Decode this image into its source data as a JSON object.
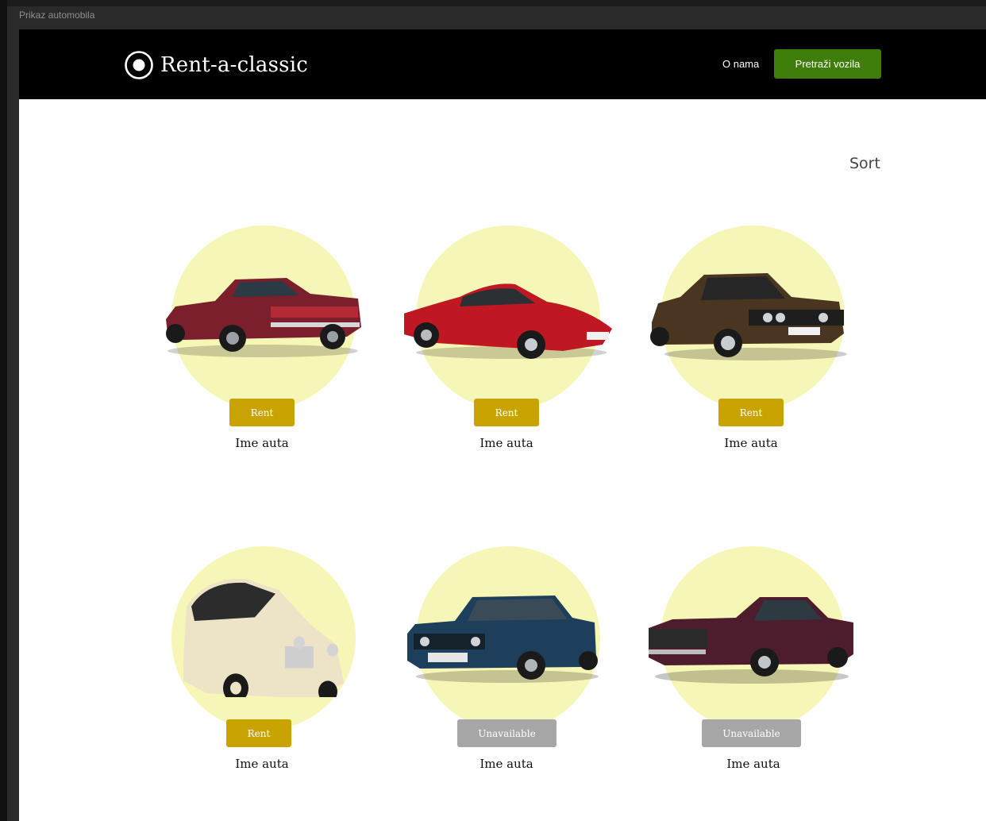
{
  "window": {
    "title": "Prikaz automobila"
  },
  "header": {
    "brand": "Rent-a-classic",
    "nav_about": "O nama",
    "nav_search_button": "Pretraži vozila"
  },
  "toolbar": {
    "sort_label": "Sort"
  },
  "colors": {
    "navbar_bg": "#000000",
    "cta_green": "#3f7d0a",
    "rent_gold": "#c9a302",
    "unavailable_gray": "#a6a6a6",
    "circle_yellow": "#f6f6b7"
  },
  "cars": [
    {
      "name": "Ime auta",
      "action": "Rent",
      "available": true,
      "body_color": "#7a1f2b",
      "icon": "classic-coupe-car-icon"
    },
    {
      "name": "Ime auta",
      "action": "Rent",
      "available": true,
      "body_color": "#c01822",
      "icon": "sports-car-icon"
    },
    {
      "name": "Ime auta",
      "action": "Rent",
      "available": true,
      "body_color": "#4a3520",
      "icon": "sedan-car-icon"
    },
    {
      "name": "Ime auta",
      "action": "Rent",
      "available": true,
      "body_color": "#ede3c6",
      "icon": "compact-car-icon"
    },
    {
      "name": "Ime auta",
      "action": "Unavailable",
      "available": false,
      "body_color": "#1d3f5c",
      "icon": "boxy-sedan-car-icon"
    },
    {
      "name": "Ime auta",
      "action": "Unavailable",
      "available": false,
      "body_color": "#4d1d2d",
      "icon": "muscle-car-icon"
    }
  ]
}
